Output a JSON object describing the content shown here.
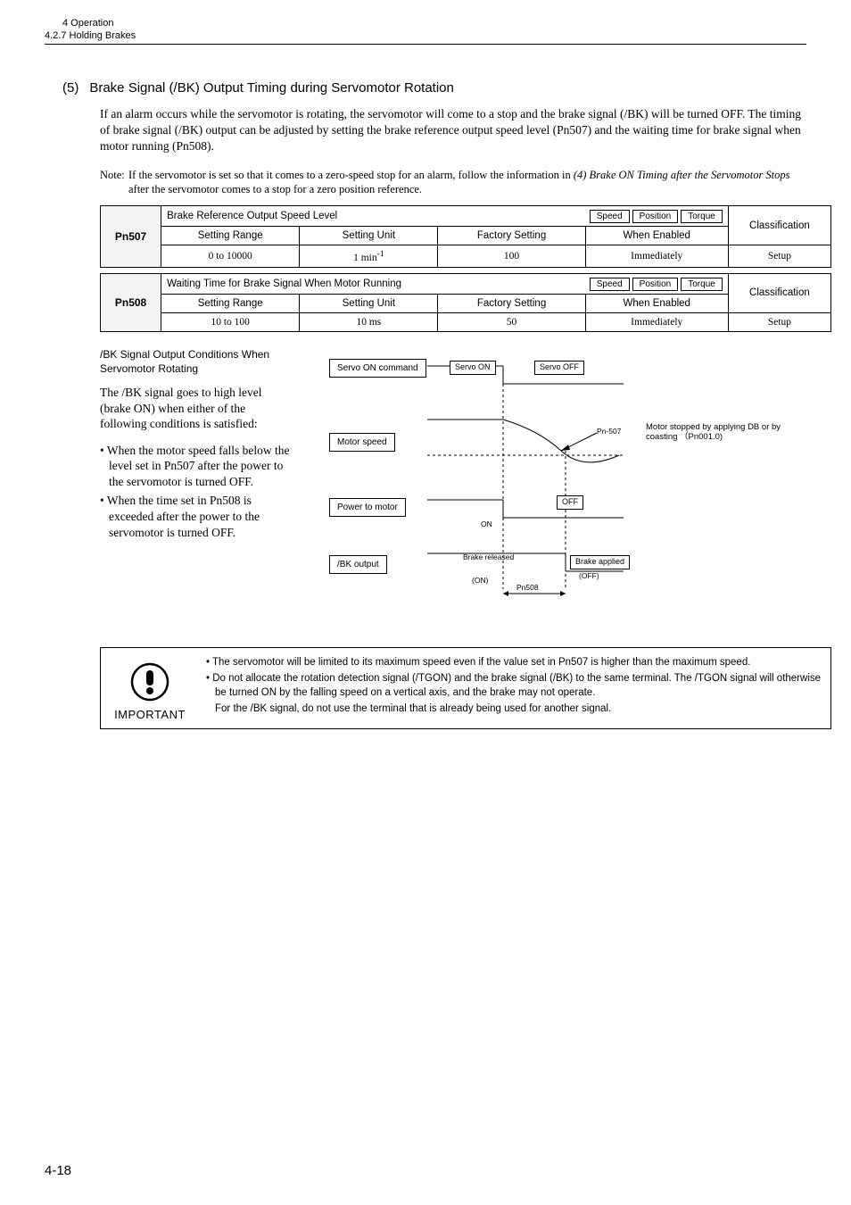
{
  "header": {
    "chapter": "4 Operation",
    "section": "4.2.7 Holding Brakes"
  },
  "section": {
    "num": "(5)",
    "title": "Brake Signal (/BK) Output Timing during Servomotor Rotation"
  },
  "body": {
    "p1": "If an alarm occurs while the servomotor is rotating, the servomotor will come to a stop and the brake signal (/BK) will be turned OFF. The timing of brake signal (/BK) output can be adjusted by setting the brake reference output speed level (Pn507) and the waiting time for brake signal when motor running (Pn508).",
    "note_label": "Note:",
    "note_body1": "If the servomotor is set so that it comes to a zero-speed stop for an alarm, follow the information in ",
    "note_ref": "(4) Brake ON Timing after the Servomotor Stops",
    "note_body2": " after the servomotor comes to a stop for a zero position reference."
  },
  "badges": {
    "speed": "Speed",
    "position": "Position",
    "torque": "Torque"
  },
  "classification": "Classification",
  "table_headers": {
    "range": "Setting Range",
    "unit": "Setting Unit",
    "factory": "Factory Setting",
    "enabled": "When Enabled"
  },
  "pn507": {
    "id": "Pn507",
    "title": "Brake Reference Output Speed Level",
    "range": "0 to 10000",
    "unit": "1 min",
    "unit_sup": "-1",
    "factory": "100",
    "enabled": "Immediately",
    "class": "Setup"
  },
  "pn508": {
    "id": "Pn508",
    "title": "Waiting Time for Brake Signal When Motor Running",
    "range": "10 to 100",
    "unit": "10 ms",
    "factory": "50",
    "enabled": "Immediately",
    "class": "Setup"
  },
  "bk": {
    "heading": "/BK Signal Output Conditions When Servomotor Rotating",
    "para": "The /BK signal goes to high level (brake ON) when either of the following conditions is satisfied:",
    "b1": "• When the motor speed falls below the level set in Pn507 after the power to the servomotor is turned OFF.",
    "b2": "• When the time set in Pn508 is exceeded after the power to the servomotor is turned OFF."
  },
  "diagram": {
    "servo_on_cmd": "Servo ON command",
    "servo_on": "Servo ON",
    "servo_off": "Servo OFF",
    "motor_speed": "Motor speed",
    "power_motor": "Power to motor",
    "bk_output": "/BK output",
    "on": "ON",
    "off": "OFF",
    "brake_released": "Brake released",
    "brake_applied": "Brake applied",
    "on_tiny": "(ON)",
    "off_tiny": "(OFF)",
    "pn507_label": "Pn-507",
    "pn508_label": "Pn508",
    "annot": "Motor stopped by applying DB or by coasting （Pn001.0)"
  },
  "important": {
    "label": "IMPORTANT",
    "b1": "• The servomotor will be limited to its maximum speed even if the value set in Pn507 is higher than the maximum speed.",
    "b2": "• Do not allocate the rotation detection signal (/TGON) and the brake signal (/BK) to the same terminal. The /TGON signal will otherwise be turned ON by the falling speed on a vertical axis, and the brake may not operate.",
    "b3": "For the /BK signal, do not use the terminal that is already being used for another signal."
  },
  "page_num": "4-18"
}
